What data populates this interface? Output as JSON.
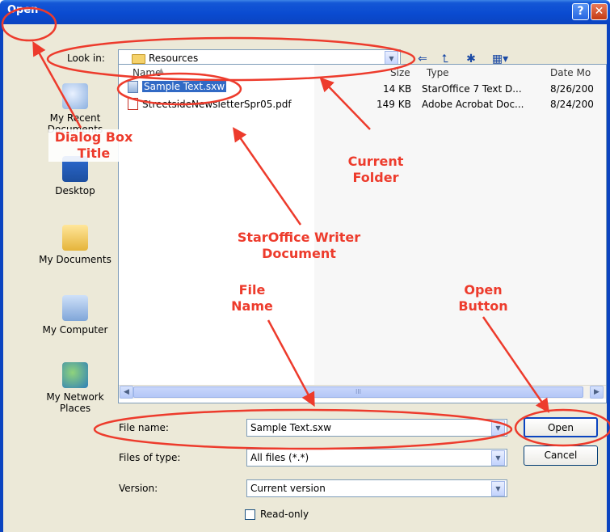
{
  "window": {
    "title": "Open",
    "help_glyph": "?",
    "close_glyph": "✕"
  },
  "look_in": {
    "label": "Look in:",
    "value": "Resources"
  },
  "places": [
    {
      "label": "My Recent Documents"
    },
    {
      "label": "Desktop"
    },
    {
      "label": "My Documents"
    },
    {
      "label": "My Computer"
    },
    {
      "label": "My Network Places"
    }
  ],
  "columns": [
    "Name",
    "Size",
    "Type",
    "Date Mo"
  ],
  "files": [
    {
      "name": "Sample Text.sxw",
      "size": "14 KB",
      "type": "StarOffice 7 Text D...",
      "date": "8/26/200",
      "selected": true
    },
    {
      "name": "StreetsideNewsletterSpr05.pdf",
      "size": "149 KB",
      "type": "Adobe Acrobat Doc...",
      "date": "8/24/200",
      "selected": false
    }
  ],
  "scroll_grip": "III",
  "form": {
    "file_name_label": "File name:",
    "file_name_value": "Sample Text.sxw",
    "files_of_type_label": "Files of type:",
    "files_of_type_value": "All files (*.*)",
    "version_label": "Version:",
    "version_value": "Current version",
    "readonly_label": "Read-only",
    "open_button": "Open",
    "cancel_button": "Cancel"
  },
  "annotations": {
    "dialog_title": "Dialog Box Title",
    "current_folder": "Current Folder",
    "staroffice_doc": "StarOffice Writer Document",
    "file_name": "File Name",
    "open_button": "Open Button"
  },
  "colors": {
    "titlebar": "#0a4bd1",
    "dialog_bg": "#ece9d8",
    "selection": "#316ac5",
    "annotation": "#ed3b2c"
  }
}
